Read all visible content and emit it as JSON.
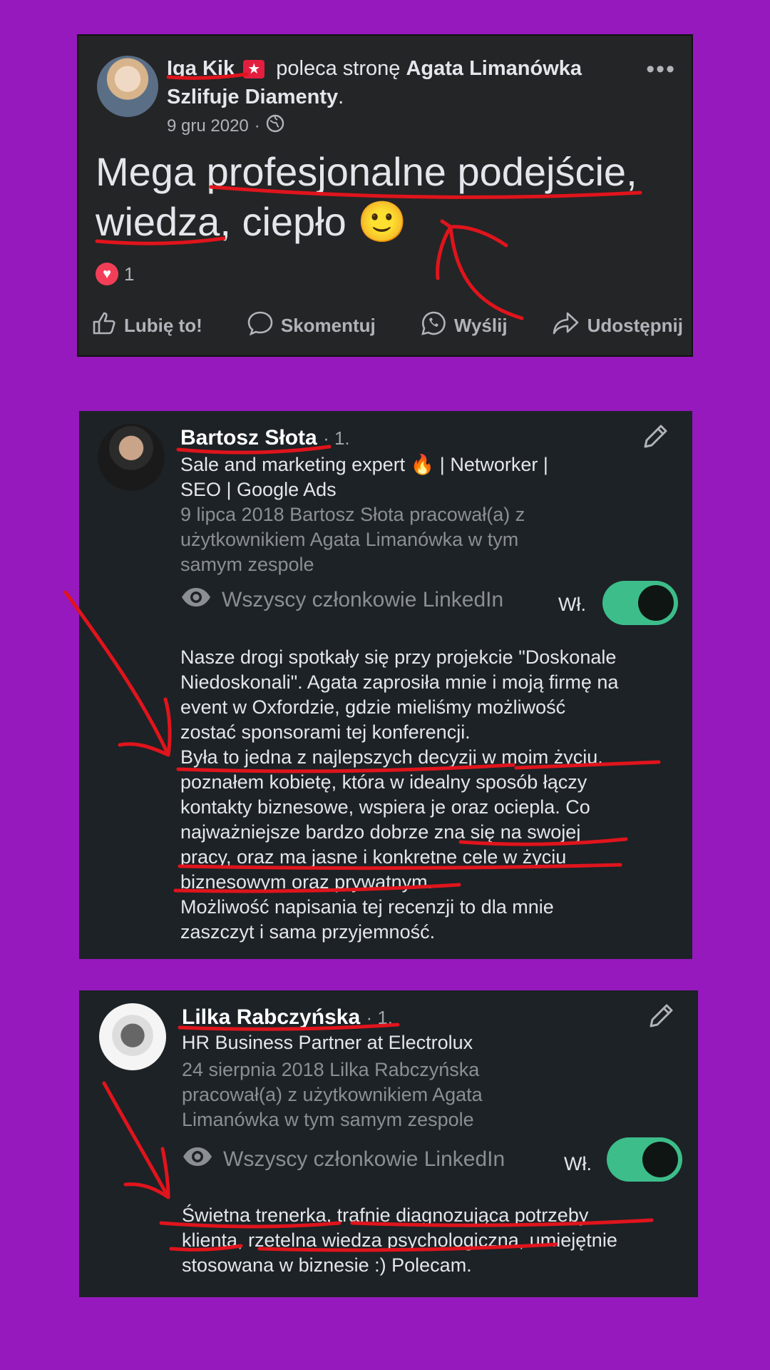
{
  "facebook": {
    "author": "Iga Kik",
    "badge_icon": "star-badge-icon",
    "recommends_text": "poleca stronę",
    "page_name": "Agata Limanówka Szlifuje Diamenty",
    "page_name_end": ".",
    "date": "9 gru 2020",
    "separator": "·",
    "post_part1": "Mega ",
    "post_part2": "profesjonalne podejście",
    "post_part3": ",",
    "post_part4": "wiedza",
    "post_part5": ", ciepło 🙂",
    "reaction_count": "1",
    "actions": {
      "like": "Lubię to!",
      "comment": "Skomentuj",
      "send": "Wyślij",
      "share": "Udostępnij"
    }
  },
  "linkedin_1": {
    "name": "Bartosz Słota",
    "degree": "· 1.",
    "headline_1": "Sale and marketing expert 🔥 | Networker |",
    "headline_2": "SEO | Google Ads",
    "meta_1": "9 lipca 2018 Bartosz Słota pracował(a) z",
    "meta_2": "użytkownikiem Agata Limanówka w tym",
    "meta_3": "samym zespole",
    "visibility": "Wszyscy członkowie LinkedIn",
    "toggle_label": "Wł.",
    "lines": [
      "Nasze drogi spotkały się przy projekcie \"Doskonale",
      "Niedoskonali\". Agata zaprosiła mnie i moją firmę na",
      "event w Oxfordzie, gdzie mieliśmy możliwość",
      "zostać sponsorami tej konferencji.",
      "Była to jedna z najlepszych decyzji w moim życiu,",
      "poznałem kobietę, która w idealny sposób łączy",
      "kontakty biznesowe, wspiera je oraz ociepla. Co",
      "najważniejsze bardzo dobrze zna się na swojej",
      "pracy, oraz ma jasne i konkretne cele w życiu",
      "biznesowym oraz prywatnym.",
      "Możliwość napisania tej recenzji to dla mnie",
      "zaszczyt i sama przyjemność."
    ]
  },
  "linkedin_2": {
    "name": "Lilka Rabczyńska",
    "degree": "· 1.",
    "headline_1": "HR Business Partner at Electrolux",
    "meta_1": "24 sierpnia 2018 Lilka Rabczyńska",
    "meta_2": "pracował(a) z użytkownikiem Agata",
    "meta_3": "Limanówka w tym samym zespole",
    "visibility": "Wszyscy członkowie LinkedIn",
    "toggle_label": "Wł.",
    "lines": [
      "Świetna trenerka, trafnie diagnozująca potrzeby",
      "klienta, rzetelna wiedza psychologiczna, umiejętnie",
      "stosowana w biznesie :) Polecam."
    ]
  },
  "colors": {
    "background": "#9619bd",
    "annotation": "#e0141c",
    "toggle": "#3cbd8a"
  }
}
